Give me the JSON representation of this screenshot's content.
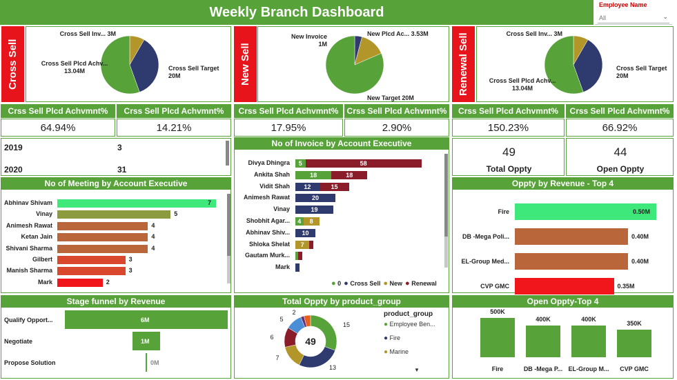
{
  "header": {
    "title": "Weekly Branch Dashboard"
  },
  "filter": {
    "label": "Employee Name",
    "value": "All"
  },
  "cross_sell": {
    "side_label": "Cross Sell",
    "pie": [
      {
        "label": "Cross Sell Inv... 3M",
        "value": 3,
        "color": "#b39629"
      },
      {
        "label": "Cross Sell Plcd Achv...",
        "sub": "13.04M",
        "value": 13.04,
        "color": "#2f3b6e"
      },
      {
        "label": "Cross Sell Target",
        "sub": "20M",
        "value": 20,
        "color": "#58a23a"
      }
    ],
    "kpis": [
      {
        "label": "Crss Sell Plcd Achvmnt%",
        "value": "64.94%"
      },
      {
        "label": "Crss Sell Plcd Achvmnt%",
        "value": "14.21%"
      }
    ]
  },
  "new_sell": {
    "side_label": "New Sell",
    "pie": [
      {
        "label": "New Invoice",
        "sub": "1M",
        "value": 1,
        "color": "#2f3b6e"
      },
      {
        "label": "New Plcd Ac... 3.53M",
        "value": 3.53,
        "color": "#b39629"
      },
      {
        "label": "New Target 20M",
        "value": 20,
        "color": "#58a23a"
      }
    ],
    "kpis": [
      {
        "label": "Crss Sell Plcd Achvmnt%",
        "value": "17.95%"
      },
      {
        "label": "Crss Sell Plcd Achvmnt%",
        "value": "2.90%"
      }
    ]
  },
  "renewal_sell": {
    "side_label": "Renewal Sell",
    "pie": [
      {
        "label": "Cross Sell Inv... 3M",
        "value": 3,
        "color": "#b39629"
      },
      {
        "label": "Cross Sell Plcd Achv...",
        "sub": "13.04M",
        "value": 13.04,
        "color": "#2f3b6e"
      },
      {
        "label": "Cross Sell Target",
        "sub": "20M",
        "value": 20,
        "color": "#58a23a"
      }
    ],
    "kpis": [
      {
        "label": "Crss Sell Plcd Achvmnt%",
        "value": "150.23%"
      },
      {
        "label": "Crss Sell Plcd Achvmnt%",
        "value": "66.92%"
      }
    ]
  },
  "year_table": [
    {
      "year": "2019",
      "value": "3"
    },
    {
      "year": "2020",
      "value": "31"
    }
  ],
  "oppty_cards": [
    {
      "value": "49",
      "label": "Total Oppty"
    },
    {
      "value": "44",
      "label": "Open Oppty"
    }
  ],
  "meetings": {
    "title": "No of Meeting by Account Executive",
    "max": 7,
    "rows": [
      {
        "name": "Abhinav Shivam",
        "value": 7,
        "color": "#3ee87a"
      },
      {
        "name": "Vinay",
        "value": 5,
        "color": "#8c9b3e"
      },
      {
        "name": "Animesh Rawat",
        "value": 4,
        "color": "#b8663a"
      },
      {
        "name": "Ketan Jain",
        "value": 4,
        "color": "#b8663a"
      },
      {
        "name": "Shivani Sharma",
        "value": 4,
        "color": "#b8663a"
      },
      {
        "name": "Gilbert",
        "value": 3,
        "color": "#d9482c"
      },
      {
        "name": "Manish Sharma",
        "value": 3,
        "color": "#d9482c"
      },
      {
        "name": "Mark",
        "value": 2,
        "color": "#f0161c"
      }
    ]
  },
  "invoices": {
    "title": "No of Invoice by Account Executive",
    "legend": [
      {
        "label": "0",
        "color": "#58a23a"
      },
      {
        "label": "Cross Sell",
        "color": "#2f3b6e"
      },
      {
        "label": "New",
        "color": "#b39629"
      },
      {
        "label": "Renewal",
        "color": "#8b1c2a"
      }
    ],
    "rows": [
      {
        "name": "Divya Dhingra",
        "segs": [
          {
            "v": 5,
            "c": "#58a23a",
            "t": "5"
          },
          {
            "v": 58,
            "c": "#8b1c2a",
            "t": "58"
          }
        ]
      },
      {
        "name": "Ankita Shah",
        "segs": [
          {
            "v": 18,
            "c": "#58a23a",
            "t": "18"
          },
          {
            "v": 18,
            "c": "#8b1c2a",
            "t": "18"
          }
        ]
      },
      {
        "name": "Vidit Shah",
        "segs": [
          {
            "v": 12,
            "c": "#2f3b6e",
            "t": "12"
          },
          {
            "v": 15,
            "c": "#8b1c2a",
            "t": "15"
          }
        ]
      },
      {
        "name": "Animesh Rawat",
        "segs": [
          {
            "v": 20,
            "c": "#2f3b6e",
            "t": "20"
          }
        ]
      },
      {
        "name": "Vinay",
        "segs": [
          {
            "v": 19,
            "c": "#2f3b6e",
            "t": "19"
          }
        ]
      },
      {
        "name": "Shobhit Agar...",
        "segs": [
          {
            "v": 4,
            "c": "#58a23a",
            "t": "4"
          },
          {
            "v": 8,
            "c": "#b39629",
            "t": "8"
          }
        ]
      },
      {
        "name": "Abhinav Shiv...",
        "segs": [
          {
            "v": 10,
            "c": "#2f3b6e",
            "t": "10"
          }
        ]
      },
      {
        "name": "Shloka Shelat",
        "segs": [
          {
            "v": 7,
            "c": "#b39629",
            "t": "7"
          },
          {
            "v": 2,
            "c": "#8b1c2a",
            "t": ""
          }
        ]
      },
      {
        "name": "Gautam Murk...",
        "segs": [
          {
            "v": 1,
            "c": "#58a23a",
            "t": ""
          },
          {
            "v": 2,
            "c": "#8b1c2a",
            "t": ""
          }
        ]
      },
      {
        "name": "Mark",
        "segs": [
          {
            "v": 2,
            "c": "#2f3b6e",
            "t": ""
          }
        ]
      }
    ]
  },
  "oppty_revenue": {
    "title": "Oppty by Revenue - Top 4",
    "max": 0.5,
    "rows": [
      {
        "name": "Fire",
        "value": 0.5,
        "label": "0.50M",
        "color": "#3ee87a"
      },
      {
        "name": "DB -Mega Poli...",
        "value": 0.4,
        "label": "0.40M",
        "color": "#b8663a"
      },
      {
        "name": "EL-Group Med...",
        "value": 0.4,
        "label": "0.40M",
        "color": "#b8663a"
      },
      {
        "name": "CVP GMC",
        "value": 0.35,
        "label": "0.35M",
        "color": "#f0161c"
      }
    ]
  },
  "stage_funnel": {
    "title": "Stage funnel by Revenue",
    "max": 6,
    "rows": [
      {
        "name": "Qualify Opport...",
        "value": 6,
        "label": "6M"
      },
      {
        "name": "Negotiate",
        "value": 1,
        "label": "1M"
      },
      {
        "name": "Propose Solution",
        "value": 0.05,
        "label": "0M"
      }
    ]
  },
  "product_group": {
    "title": "Total Oppty by product_group",
    "center": "49",
    "legend_title": "product_group",
    "legend": [
      {
        "label": "Employee Ben...",
        "color": "#58a23a"
      },
      {
        "label": "Fire",
        "color": "#2f3b6e"
      },
      {
        "label": "Marine",
        "color": "#b39629"
      }
    ],
    "slices": [
      {
        "value": 15,
        "label": "15",
        "color": "#58a23a"
      },
      {
        "value": 13,
        "label": "13",
        "color": "#2f3b6e"
      },
      {
        "value": 7,
        "label": "7",
        "color": "#b39629"
      },
      {
        "value": 6,
        "label": "6",
        "color": "#8b1c2a"
      },
      {
        "value": 5,
        "label": "5",
        "color": "#4a8fd6"
      },
      {
        "value": 1,
        "label": "",
        "color": "#6b2f7a"
      },
      {
        "value": 2,
        "label": "2",
        "color": "#e8601c"
      }
    ]
  },
  "open_oppty": {
    "title": "Open Oppty-Top 4",
    "max": 500,
    "rows": [
      {
        "name": "Fire",
        "value": 500,
        "label": "500K"
      },
      {
        "name": "DB -Mega P...",
        "value": 400,
        "label": "400K"
      },
      {
        "name": "EL-Group M...",
        "value": 400,
        "label": "400K"
      },
      {
        "name": "CVP GMC",
        "value": 350,
        "label": "350K"
      }
    ]
  }
}
